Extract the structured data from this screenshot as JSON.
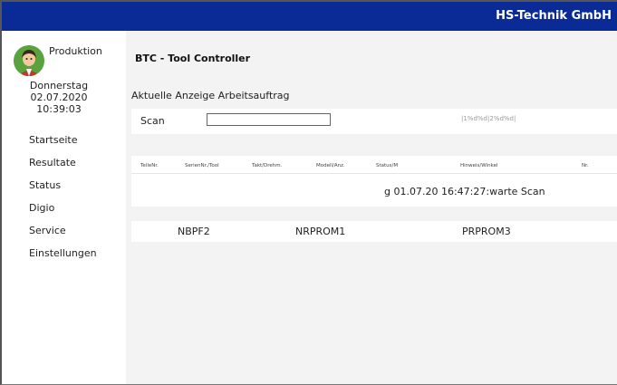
{
  "header": {
    "company": "HS-Technik GmbH"
  },
  "user": {
    "name": "Produktion"
  },
  "datetime": {
    "weekday": "Donnerstag",
    "date": "02.07.2020",
    "time": "10:39:03"
  },
  "nav": [
    {
      "label": "Startseite"
    },
    {
      "label": "Resultate"
    },
    {
      "label": "Status"
    },
    {
      "label": "Digio"
    },
    {
      "label": "Service"
    },
    {
      "label": "Einstellungen"
    }
  ],
  "main": {
    "title": "BTC - Tool Controller",
    "section_label": "Aktuelle Anzeige Arbeitsauftrag",
    "scan": {
      "label": "Scan",
      "value": "",
      "format_hint": "|1%d%d|2%d%d|"
    },
    "table": {
      "headers": [
        "TeileNr.",
        "SerienNr./Tool",
        "Takt/Drehm.",
        "Modell/Anz.",
        "Status/M",
        "Hinweis/Winkel",
        "Nr."
      ],
      "row_text": "g 01.07.20 16:47:27:warte Scan"
    },
    "tools": [
      "NBPF2",
      "NRPROM1",
      "PRPROM3"
    ]
  },
  "colors": {
    "topbar": "#0a2a96",
    "avatar_bg": "#59a23e",
    "content_bg": "#f3f3f3"
  }
}
